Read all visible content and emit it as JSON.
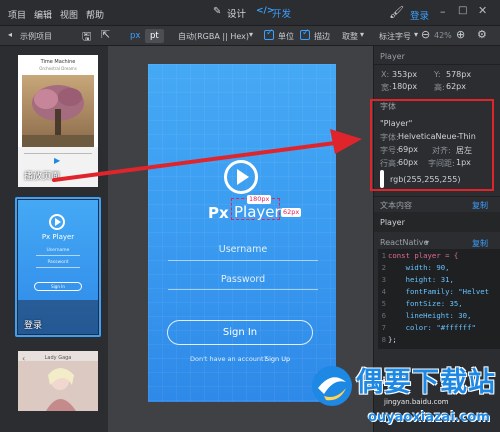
{
  "menu": {
    "items": [
      "项目",
      "编辑",
      "视图",
      "帮助"
    ],
    "mode_design": "设计",
    "mode_dev": "开发",
    "login": "登录"
  },
  "toolbar": {
    "project_name": "示例项目",
    "unit_px": "px",
    "unit_pt": "pt",
    "color_format": "自动(RGBA || Hex)",
    "check_unit": "单位",
    "check_stroke": "描边",
    "round": "取整",
    "annotate_font": "标注字号",
    "zoom": "42%"
  },
  "left": {
    "thumb1_title": "Time Machine",
    "thumb1_subtitle": "Orchestral Dreams",
    "thumb1_label": "播放页面",
    "thumb2_logo": "Px Player",
    "thumb2_field1": "Username",
    "thumb2_field2": "Password",
    "thumb2_btn": "Sign In",
    "thumb2_label": "登录",
    "thumb3_title": "Lady Gaga"
  },
  "screen": {
    "logo_prefix": "Px",
    "logo_word": "Player",
    "width_badge": "180px",
    "height_badge": "62px",
    "username": "Username",
    "password": "Password",
    "signin": "Sign In",
    "no_account": "Don't have an account?",
    "signup": "Sign Up"
  },
  "right": {
    "layer_name": "Player",
    "x_label": "X:",
    "x_value": "353px",
    "y_label": "Y:",
    "y_value": "578px",
    "w_label": "宽:",
    "w_value": "180px",
    "h_label": "高:",
    "h_value": "62px",
    "font_section": "字体",
    "font_text": "\"Player\"",
    "font_label": "字体:",
    "font_name": "HelveticaNeue-Thin",
    "size_label": "字号:",
    "size_value": "69px",
    "align_label": "对齐:",
    "align_value": "居左",
    "lh_label": "行高:",
    "lh_value": "60px",
    "ls_label": "字间距:",
    "ls_value": "1px",
    "color_value": "rgb(255,255,255)",
    "content_section": "文本内容",
    "copy_1": "复制",
    "content_value": "Player",
    "code_section": "ReactNative",
    "copy_2": "复制",
    "code_lines": [
      "const player = {",
      "    width: 90,",
      "    height: 31,",
      "    fontFamily: \"Helvet",
      "    fontSize: 35,",
      "    lineHeight: 30,",
      "    color: \"#ffffff\"",
      "};"
    ],
    "line_numbers": [
      "1",
      "2",
      "3",
      "4",
      "5",
      "6",
      "7",
      "8"
    ]
  },
  "watermark": {
    "title": "偶要下载站",
    "baidu_url": "jingyan.baidu.com",
    "url": "ouyaoxiazai.com"
  },
  "colors": {
    "accent": "#3aa0ff",
    "phone_blue": "#3a9bf0",
    "annotation_red": "#e0242b",
    "badge_pink": "#e0245e"
  }
}
